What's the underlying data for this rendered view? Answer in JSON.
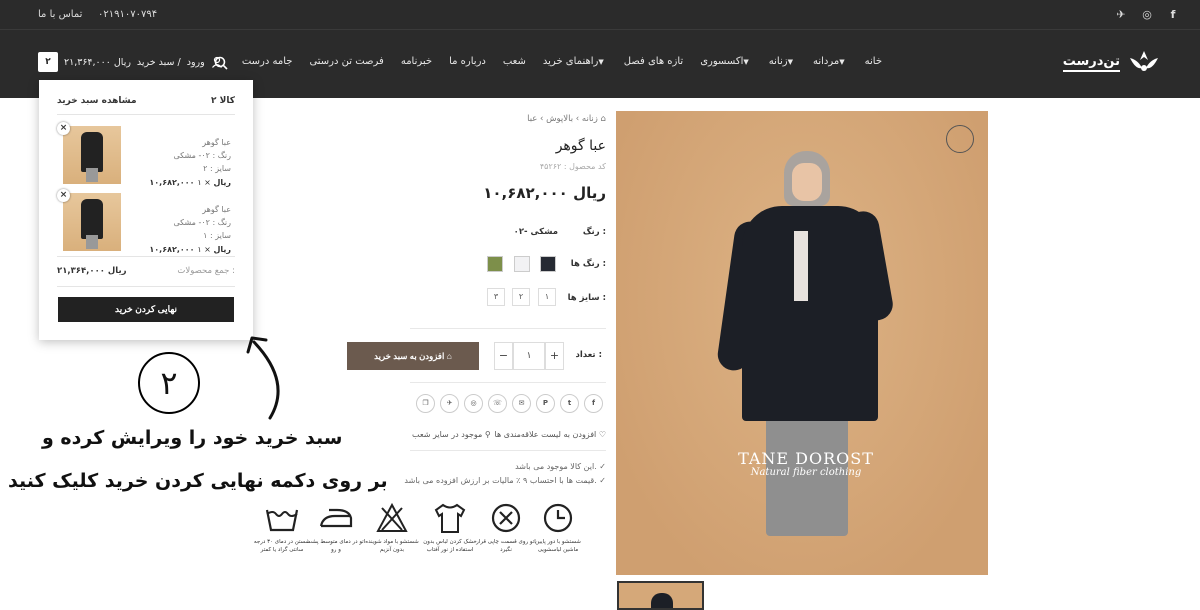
{
  "topbar": {
    "phone": "۰۲۱۹۱۰۷۰۷۹۴",
    "contact": "تماس با ما"
  },
  "header": {
    "brand": "تن‌درست",
    "nav": [
      "خانه",
      "مردانه",
      "زنانه",
      "اکسسوری",
      "تازه های فصل",
      "راهنمای خرید",
      "شعب",
      "درباره ما",
      "خبرنامه",
      "فرصت تن درستی",
      "جامه درست"
    ],
    "login": "ورود",
    "cart_label": "سبد خرید /",
    "cart_total": "۲۱,۳۶۴,۰۰۰ ریال",
    "cart_count": "۲"
  },
  "minicart": {
    "count_label": "۲ کالا",
    "view_cart": "مشاهده سبد خرید",
    "items": [
      {
        "name": "عبا گوهر",
        "color": "رنگ : ۰۲- مشکی",
        "size": "سایز : ۲",
        "qty": "۱",
        "price": "۱۰,۶۸۲,۰۰۰ ریال"
      },
      {
        "name": "عبا گوهر",
        "color": "رنگ : ۰۲- مشکی",
        "size": "سایز : ۱",
        "qty": "۱",
        "price": "۱۰,۶۸۲,۰۰۰ ریال"
      }
    ],
    "total_label": "جمع محصولات :",
    "total_value": "۲۱,۳۶۴,۰۰۰ ریال",
    "checkout": "نهایی کردن خرید"
  },
  "annotation": {
    "number": "۲",
    "line1": "سبد خرید خود را ویرایش کرده و",
    "line2": "بر روی دکمه نهایی کردن خرید کلیک کنید"
  },
  "product": {
    "breadcrumb": "زنانه  ›  بالاپوش  ›  عبا",
    "title": "عبا گوهر",
    "code": "کد محصول : ۴۵۲۶۲",
    "price": "۱۰,۶۸۲,۰۰۰ ریال",
    "color_label": "رنگ :",
    "color_value": "۰۲- مشکی",
    "colors_label": "رنگ ها :",
    "swatches": [
      "#262a33",
      "#f2f2f4",
      "#7d8f4a"
    ],
    "sizes_label": "سایز ها :",
    "sizes": [
      "۱",
      "۲",
      "۳"
    ],
    "qty_label": "تعداد :",
    "qty": "۱",
    "add_to_cart": "افزودن به سبد خرید",
    "wishlist": "افزودن به لیست علاقه‌مندی ها",
    "stores": "موجود در سایر شعب",
    "note1": "این کالا موجود می باشد.",
    "note2": "قیمت ها با احتساب ۹ ٪ مالیات بر ارزش افزوده می باشد.",
    "image_brand": "TANE DOROST",
    "image_sub": "Natural fiber clothing",
    "care": [
      "شستشو با دور پایین ماشین لباسشویی",
      "اتو روی قسمت چاپی قرار نگیرد",
      "خشک کردن لباس بدون استفاده از نور آفتاب",
      "شستشو با مواد شوینده بدون آنزیم",
      "اتو در دمای متوسط پشت و رو",
      "شستن در دمای ۳۰ درجه سانتی گراد یا کمتر"
    ]
  },
  "share_icons": [
    "f",
    "t",
    "p",
    "m",
    "w",
    "ig",
    "tg",
    "cp"
  ]
}
